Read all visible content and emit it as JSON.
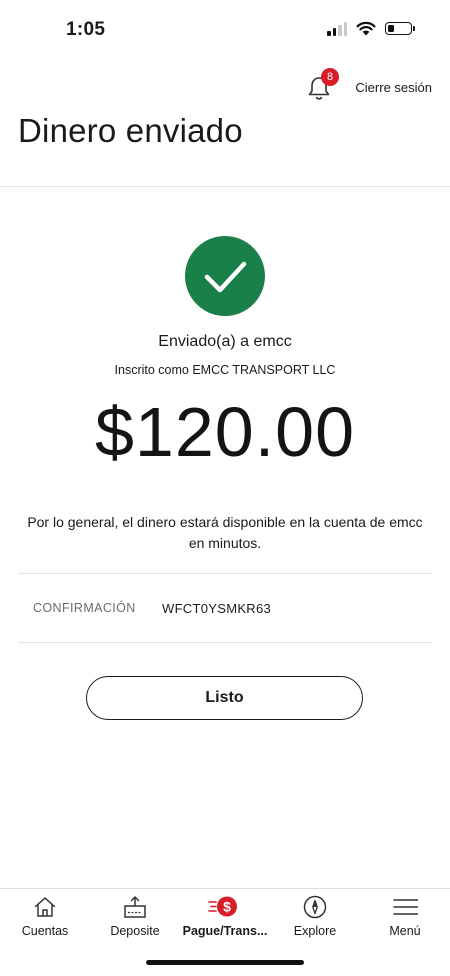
{
  "status_bar": {
    "time": "1:05",
    "battery_level": 0.3
  },
  "header": {
    "notification_count": "8",
    "signout_label": "Cierre sesión",
    "title": "Dinero enviado"
  },
  "confirmation_screen": {
    "sent_to": "Enviado(a) a emcc",
    "enrolled_as": "Inscrito como EMCC TRANSPORT LLC",
    "amount": "$120.00",
    "availability_note": "Por lo general, el dinero estará disponible en la cuenta de emcc en minutos.",
    "confirmation_label": "CONFIRMACIÓN",
    "confirmation_code": "WFCT0YSMKR63",
    "done_label": "Listo"
  },
  "colors": {
    "success": "#198049",
    "badge": "#d71e28",
    "text": "#1a1a1a"
  },
  "bottom_nav": {
    "items": [
      {
        "label": "Cuentas",
        "icon": "home-icon"
      },
      {
        "label": "Deposite",
        "icon": "deposit-icon"
      },
      {
        "label": "Pague/Trans...",
        "icon": "pay-transfer-icon",
        "active": true
      },
      {
        "label": "Explore",
        "icon": "compass-icon"
      },
      {
        "label": "Menú",
        "icon": "menu-icon"
      }
    ]
  }
}
